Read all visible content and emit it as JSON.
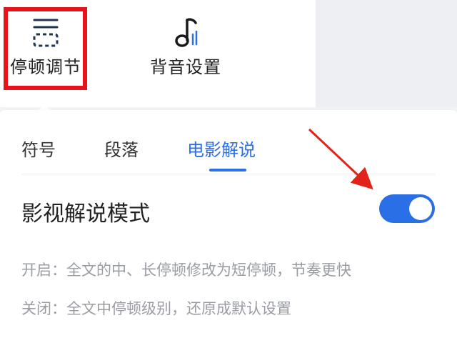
{
  "toolbar": {
    "pause_label": "停顿调节",
    "bgm_label": "背音设置"
  },
  "tabs": [
    {
      "label": "符号",
      "active": false
    },
    {
      "label": "段落",
      "active": false
    },
    {
      "label": "电影解说",
      "active": true
    }
  ],
  "mode": {
    "title": "影视解说模式",
    "enabled": true
  },
  "descriptions": {
    "on": "开启：全文的中、长停顿修改为短停顿，节奏更快",
    "off": "关闭：全文中停顿级别，还原成默认设置"
  },
  "colors": {
    "accent": "#2b6fe6",
    "highlight": "#e8121a",
    "arrow": "#e2231a"
  },
  "icons": {
    "pause": "pause-adjust-icon",
    "bgm": "music-note-icon"
  }
}
